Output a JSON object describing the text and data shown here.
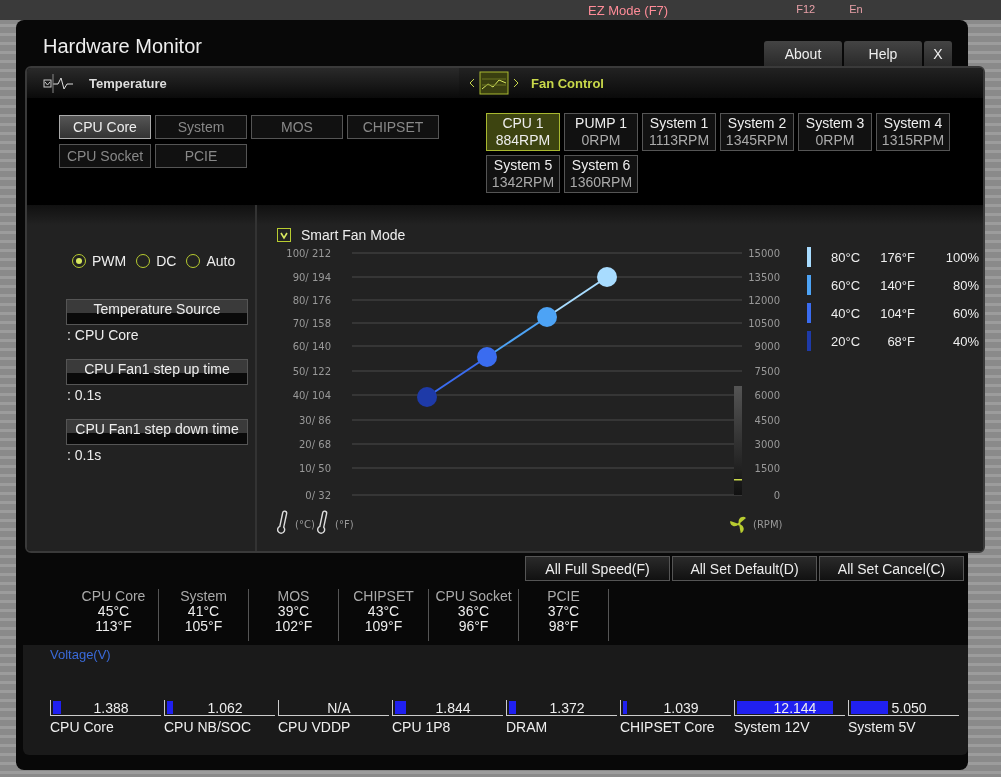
{
  "background": {
    "mode_label": "EZ Mode (F7)",
    "hotkey": "F12",
    "language": "En"
  },
  "window": {
    "title": "Hardware Monitor"
  },
  "header_tabs": [
    {
      "label": "About"
    },
    {
      "label": "Help"
    },
    {
      "label": "X"
    }
  ],
  "temperature": {
    "title": "Temperature",
    "sensors": [
      {
        "label": "CPU Core",
        "selected": true
      },
      {
        "label": "System",
        "selected": false
      },
      {
        "label": "MOS",
        "selected": false
      },
      {
        "label": "CHIPSET",
        "selected": false
      },
      {
        "label": "CPU Socket",
        "selected": false
      },
      {
        "label": "PCIE",
        "selected": false
      }
    ]
  },
  "fan_control": {
    "title": "Fan Control",
    "fans": [
      {
        "name": "CPU 1",
        "rpm": "884RPM",
        "selected": true
      },
      {
        "name": "PUMP 1",
        "rpm": "0RPM",
        "selected": false
      },
      {
        "name": "System 1",
        "rpm": "1113RPM",
        "selected": false
      },
      {
        "name": "System 2",
        "rpm": "1345RPM",
        "selected": false
      },
      {
        "name": "System 3",
        "rpm": "0RPM",
        "selected": false
      },
      {
        "name": "System 4",
        "rpm": "1315RPM",
        "selected": false
      },
      {
        "name": "System 5",
        "rpm": "1342RPM",
        "selected": false
      },
      {
        "name": "System 6",
        "rpm": "1360RPM",
        "selected": false
      }
    ]
  },
  "fan_mode": [
    {
      "label": "PWM",
      "selected": true
    },
    {
      "label": "DC",
      "selected": false
    },
    {
      "label": "Auto",
      "selected": false
    }
  ],
  "settings": [
    {
      "label": "Temperature Source",
      "value": ": CPU Core"
    },
    {
      "label": "CPU Fan1 step up time",
      "value": ": 0.1s"
    },
    {
      "label": "CPU Fan1 step down time",
      "value": ": 0.1s"
    }
  ],
  "smart_fan": {
    "label": "Smart Fan Mode",
    "checked": true
  },
  "curve": {
    "temp_ticks": [
      "100/ 212",
      "90/ 194",
      "80/ 176",
      "70/ 158",
      "60/ 140",
      "50/ 122",
      "40/ 104",
      "30/  86",
      "20/  68",
      "10/  50",
      "0/  32"
    ],
    "rpm_ticks": [
      "15000",
      "13500",
      "12000",
      "10500",
      "9000",
      "7500",
      "6000",
      "4500",
      "3000",
      "1500",
      "0"
    ],
    "temp_units": [
      "(°C)",
      "(°F)"
    ],
    "rpm_unit": "(RPM)",
    "points": [
      {
        "celsius": "80°C",
        "fahrenheit": "176°F",
        "percent": "100%",
        "color": "#a8dcff"
      },
      {
        "celsius": "60°C",
        "fahrenheit": "140°F",
        "percent": "80%",
        "color": "#4da3f5"
      },
      {
        "celsius": "40°C",
        "fahrenheit": "104°F",
        "percent": "60%",
        "color": "#3a6cf0"
      },
      {
        "celsius": "20°C",
        "fahrenheit": "68°F",
        "percent": "40%",
        "color": "#1e3aa8"
      }
    ]
  },
  "actions": [
    {
      "label": "All Full Speed(F)"
    },
    {
      "label": "All Set Default(D)"
    },
    {
      "label": "All Set Cancel(C)"
    }
  ],
  "readings": [
    {
      "name": "CPU Core",
      "celsius": "45°C",
      "fahrenheit": "113°F"
    },
    {
      "name": "System",
      "celsius": "41°C",
      "fahrenheit": "105°F"
    },
    {
      "name": "MOS",
      "celsius": "39°C",
      "fahrenheit": "102°F"
    },
    {
      "name": "CHIPSET",
      "celsius": "43°C",
      "fahrenheit": "109°F"
    },
    {
      "name": "CPU Socket",
      "celsius": "36°C",
      "fahrenheit": "96°F"
    },
    {
      "name": "PCIE",
      "celsius": "37°C",
      "fahrenheit": "98°F"
    }
  ],
  "voltage": {
    "title": "Voltage(V)",
    "rails": [
      {
        "name": "CPU Core",
        "value": "1.388",
        "level": 0.07
      },
      {
        "name": "CPU NB/SOC",
        "value": "1.062",
        "level": 0.05
      },
      {
        "name": "CPU VDDP",
        "value": "N/A"
      },
      {
        "name": "CPU 1P8",
        "value": "1.844",
        "level": 0.1
      },
      {
        "name": "DRAM",
        "value": "1.372",
        "level": 0.06
      },
      {
        "name": "CHIPSET Core",
        "value": "1.039",
        "level": 0.04
      },
      {
        "name": "System 12V",
        "value": "12.144",
        "level": 0.87
      },
      {
        "name": "System 5V",
        "value": "5.050",
        "level": 0.34
      }
    ]
  }
}
